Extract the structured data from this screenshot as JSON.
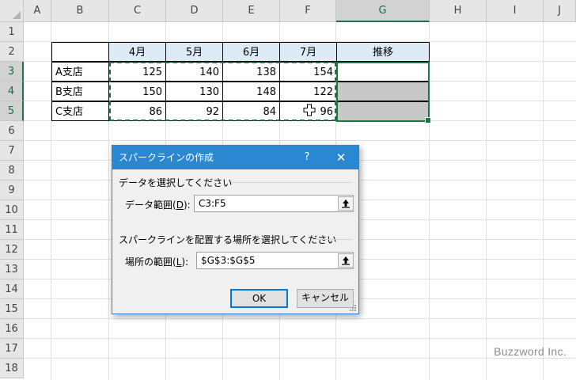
{
  "sheet": {
    "columns": [
      "A",
      "B",
      "C",
      "D",
      "E",
      "F",
      "G",
      "H",
      "I",
      "J"
    ],
    "rows": [
      "1",
      "2",
      "3",
      "4",
      "5",
      "6",
      "7",
      "8",
      "9",
      "10",
      "11",
      "12",
      "13",
      "14",
      "15",
      "16",
      "17",
      "18"
    ],
    "header_row": [
      "4月",
      "5月",
      "6月",
      "7月",
      "推移"
    ],
    "branches": [
      "A支店",
      "B支店",
      "C支店"
    ],
    "values": [
      [
        "125",
        "140",
        "138",
        "154"
      ],
      [
        "150",
        "130",
        "148",
        "122"
      ],
      [
        "86",
        "92",
        "84",
        "96"
      ]
    ],
    "selected_column": "G",
    "selected_rows": [
      "3",
      "4",
      "5"
    ]
  },
  "dialog": {
    "title": "スパークラインの作成",
    "help": "?",
    "close": "✕",
    "data_section_label": "データを選択してください",
    "data_range_label": "データ範囲",
    "data_range_hotkey": "D",
    "data_range_value": "C3:F5",
    "location_section_label": "スパークラインを配置する場所を選択してください",
    "location_range_label": "場所の範囲",
    "location_range_hotkey": "L",
    "location_range_value": "$G$3:$G$5",
    "ok_label": "OK",
    "cancel_label": "キャンセル"
  },
  "watermark": "Buzzword Inc.",
  "colors": {
    "accent_green": "#217346",
    "dialog_blue": "#2b87d1",
    "header_fill": "#ddebf7",
    "sparkline_cell_fill": "#c8c8c8"
  }
}
